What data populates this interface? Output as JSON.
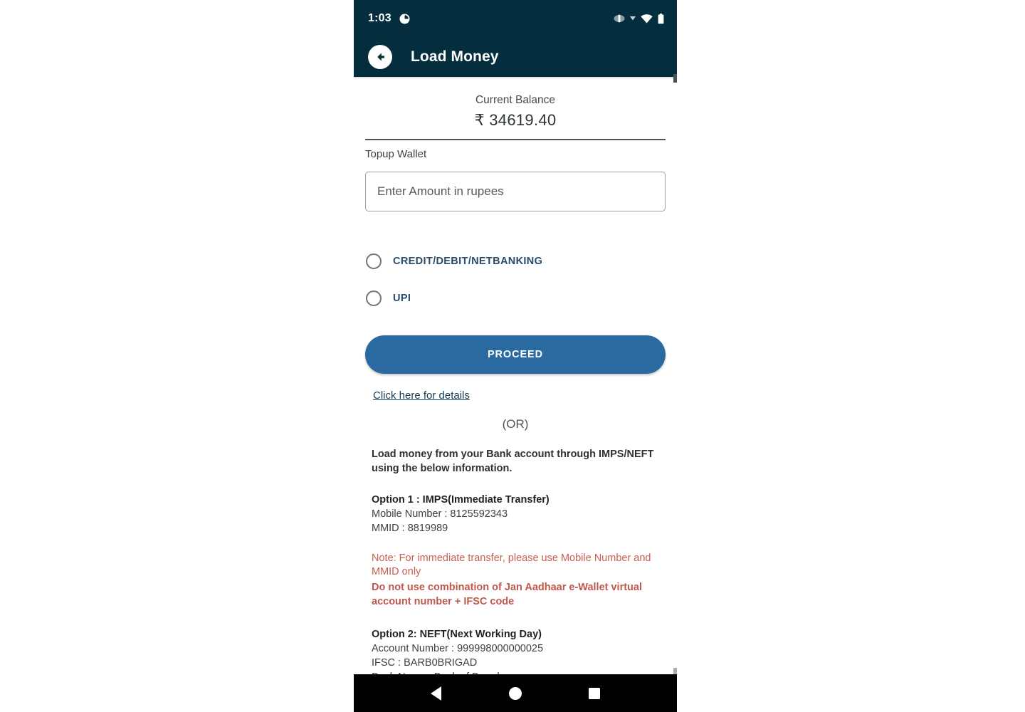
{
  "statusbar": {
    "time": "1:03",
    "notification_icon": "notification-circle-icon",
    "icons": [
      "vibrate-icon",
      "dropdown-caret-icon",
      "wifi-icon",
      "battery-icon"
    ]
  },
  "appbar": {
    "back_icon": "back-arrow-icon",
    "title": "Load Money",
    "background_color": "#042e3e"
  },
  "balance": {
    "label": "Current Balance",
    "value": "₹ 34619.40"
  },
  "topup": {
    "label": "Topup Wallet",
    "input_value": "",
    "input_placeholder": "Enter Amount in rupees"
  },
  "payment_methods": [
    {
      "id": "card",
      "label": "CREDIT/DEBIT/NETBANKING",
      "selected": false
    },
    {
      "id": "upi",
      "label": "UPI",
      "selected": false
    }
  ],
  "actions": {
    "proceed_label": "PROCEED",
    "proceed_color": "#2a6aa0",
    "details_link": "Click here for details",
    "or_text": "(OR)"
  },
  "info": {
    "intro": "Load money from your Bank account through IMPS/NEFT using the below information.",
    "option1": {
      "title": "Option 1 : IMPS(Immediate Transfer)",
      "lines": [
        "Mobile Number : 8125592343",
        "MMID : 8819989"
      ]
    },
    "note": "Note: For immediate transfer, please use Mobile Number and MMID only",
    "note_bold": "Do not use combination of Jan Aadhaar e-Wallet virtual account number + IFSC code",
    "note_color": "#c65f52",
    "option2": {
      "title": "Option 2: NEFT(Next Working Day)",
      "lines": [
        "Account Number : 999998000000025",
        "IFSC : BARB0BRIGAD",
        "Bank Name : Bank of Baroda"
      ]
    }
  },
  "navbar": {
    "back": "nav-back-icon",
    "home": "nav-home-icon",
    "recents": "nav-recents-icon"
  }
}
